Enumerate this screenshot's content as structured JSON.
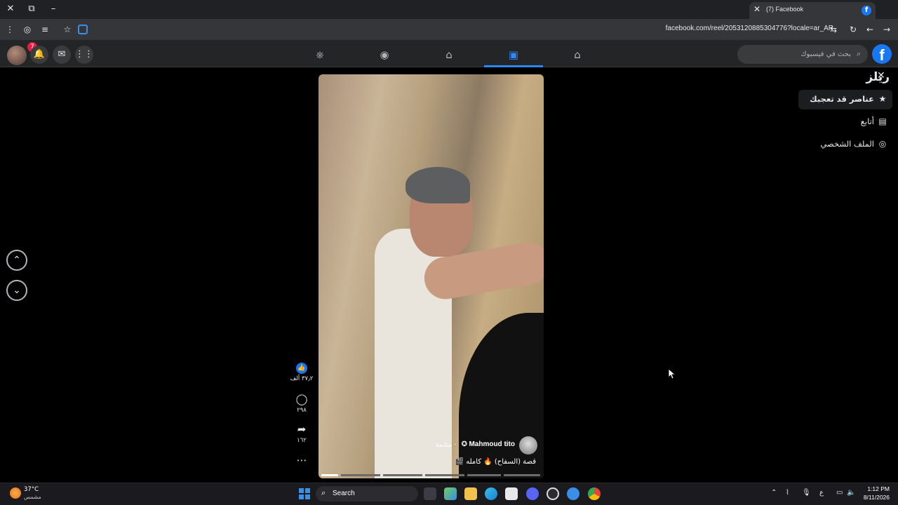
{
  "browser": {
    "tab_title": "(7) Facebook",
    "url": "facebook.com/reel/2053120885304776?locale=ar_AR",
    "icons": [
      "close-icon",
      "restore-icon",
      "minimize-icon",
      "new-tab-icon",
      "menu-icon",
      "extensions-icon",
      "star-icon"
    ]
  },
  "header": {
    "notification_count": "7",
    "search_placeholder": "بحث في فيسبوك",
    "logo": "f",
    "nav_icons": [
      "gaming-icon",
      "groups-icon",
      "marketplace-icon",
      "reels-icon",
      "home-icon"
    ],
    "active_nav": "reels-icon"
  },
  "sidebar": {
    "title": "ريلز",
    "items": [
      {
        "label": "عناصر قد تعجبك",
        "icon": "star-icon",
        "selected": true
      },
      {
        "label": "أتابع",
        "icon": "following-icon",
        "selected": false
      },
      {
        "label": "الملف الشخصي",
        "icon": "profile-icon",
        "selected": false
      }
    ]
  },
  "reel": {
    "author": "Mahmoud tito",
    "follow_label": "· متابعة",
    "caption": "قصة (السفاح) 🔥 كامله 🎬",
    "likes": "٣٧٫٢ ألف",
    "comments": "٢٩٨",
    "shares": "١٦٢"
  },
  "taskbar": {
    "temperature": "37°C",
    "weather_desc": "مشمس",
    "search_label": "Search",
    "time": "1:12 PM",
    "date": "8/11/2026",
    "lang": "ع"
  },
  "colors": {
    "accent": "#2d88ff",
    "brand": "#1877f2",
    "bg": "#000000"
  }
}
